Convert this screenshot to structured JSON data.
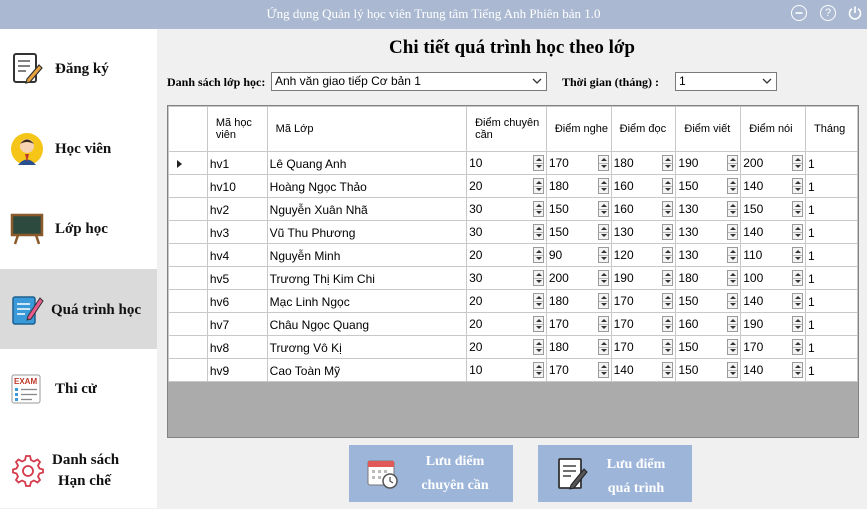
{
  "window": {
    "title": "Ứng dụng Quản lý học viên Trung tâm Tiếng Anh Phiên bản 1.0",
    "help_glyph": "?"
  },
  "sidebar": {
    "items": [
      {
        "label": "Đăng ký",
        "icon": "register-icon",
        "active": false
      },
      {
        "label": "Học viên",
        "icon": "student-icon",
        "active": false
      },
      {
        "label": "Lớp học",
        "icon": "classroom-board-icon",
        "active": false
      },
      {
        "label": "Quá trình học",
        "icon": "study-progress-icon",
        "active": true
      },
      {
        "label": "Thi cử",
        "icon": "exam-icon",
        "active": false
      },
      {
        "label_line1": "Danh sách",
        "label_line2": "Hạn chế",
        "icon": "settings-gear-icon",
        "active": false
      }
    ]
  },
  "main": {
    "heading": "Chi tiết quá trình học theo lớp",
    "class_list_label": "Danh sách lớp học:",
    "class_list_value": "Anh văn giao tiếp Cơ bản 1",
    "time_label": "Thời gian (tháng) :",
    "time_value": "1"
  },
  "grid": {
    "columns": [
      "Mã học viên",
      "Mã Lớp",
      "Điểm chuyên cần",
      "Điểm nghe",
      "Điểm đọc",
      "Điểm viết",
      "Điểm nói",
      "Tháng"
    ],
    "rows": [
      [
        "hv1",
        "Lê Quang Anh",
        "10",
        "170",
        "180",
        "190",
        "200",
        "1"
      ],
      [
        "hv10",
        "Hoàng Ngọc Thảo",
        "20",
        "180",
        "160",
        "150",
        "140",
        "1"
      ],
      [
        "hv2",
        "Nguyễn Xuân Nhã",
        "30",
        "150",
        "160",
        "130",
        "150",
        "1"
      ],
      [
        "hv3",
        "Vũ Thu Phương",
        "30",
        "150",
        "130",
        "130",
        "140",
        "1"
      ],
      [
        "hv4",
        "Nguyễn Minh",
        "20",
        "90",
        "120",
        "130",
        "110",
        "1"
      ],
      [
        "hv5",
        "Trương Thị Kim Chi",
        "30",
        "200",
        "190",
        "180",
        "100",
        "1"
      ],
      [
        "hv6",
        "Mạc Linh Ngọc",
        "20",
        "180",
        "170",
        "150",
        "140",
        "1"
      ],
      [
        "hv7",
        "Châu Ngọc Quang",
        "20",
        "170",
        "170",
        "160",
        "190",
        "1"
      ],
      [
        "hv8",
        "Trương Vô Kị",
        "20",
        "180",
        "170",
        "150",
        "170",
        "1"
      ],
      [
        "hv9",
        "Cao Toàn Mỹ",
        "10",
        "170",
        "140",
        "150",
        "140",
        "1"
      ]
    ],
    "selected_row": 0
  },
  "buttons": {
    "save_attendance_line1": "Lưu điểm",
    "save_attendance_line2": "chuyên cần",
    "save_progress_line1": "Lưu điểm",
    "save_progress_line2": "quá trình"
  },
  "colors": {
    "titlebar": "#aab9d1",
    "active_nav": "#dadada",
    "action_button": "#9cb5d9",
    "grid_background": "#ababab"
  }
}
